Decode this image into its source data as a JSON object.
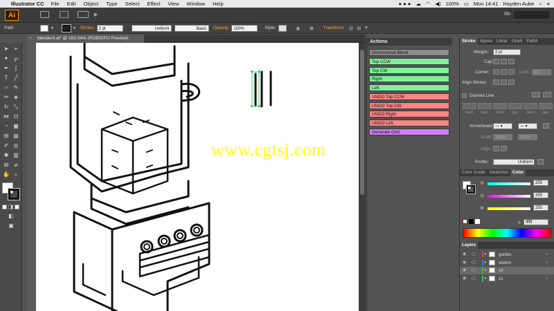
{
  "menubar": {
    "app_name": "Illustrator CC",
    "items": [
      "File",
      "Edit",
      "Object",
      "Type",
      "Select",
      "Effect",
      "View",
      "Window",
      "Help"
    ],
    "battery": "100%",
    "clock": "Mon 14:41",
    "user": "Hayden Aube"
  },
  "appbar": {
    "logo": "Ai",
    "workspace": "Illo"
  },
  "control_bar": {
    "selection_label": "Path",
    "stroke_label": "Stroke:",
    "stroke_value": "2 pt",
    "profile_label": "Uniform",
    "brush_label": "Basic",
    "opacity_label": "Opacity:",
    "opacity_value": "100%",
    "style_label": "Style:",
    "transform_label": "Transform"
  },
  "document": {
    "tab_title": "blender3.ai* @ 163.04% (RGB/GPU Preview)"
  },
  "watermark": "www.cgtsj.com",
  "actions_panel": {
    "title": "Actions",
    "set_name": "Dimensional Blend",
    "set_color": "#8e8e8e",
    "items": [
      {
        "label": "Top CCW",
        "color": "#7df29a"
      },
      {
        "label": "Top CW",
        "color": "#7df29a"
      },
      {
        "label": "Right",
        "color": "#7df29a"
      },
      {
        "label": "Left",
        "color": "#7df29a"
      },
      {
        "label": "UNDO Top CCW",
        "color": "#ff8585"
      },
      {
        "label": "UNDO Top CW",
        "color": "#ff8585"
      },
      {
        "label": "UNDO Right",
        "color": "#ff8585"
      },
      {
        "label": "UNDO Left",
        "color": "#ff8585"
      },
      {
        "label": "Generate Grid",
        "color": "#d27cf2"
      }
    ]
  },
  "stroke_panel": {
    "tabs": [
      "Stroke",
      "Appea",
      "Librar",
      "Gradi",
      "Pathfi"
    ],
    "weight_label": "Weight:",
    "weight_value": "2 pt",
    "cap_label": "Cap:",
    "corner_label": "Corner:",
    "limit_label": "Limit:",
    "limit_value": "10",
    "align_label": "Align Stroke:",
    "dashed_label": "Dashed Line",
    "dash_labels": [
      "dash",
      "gap",
      "dash",
      "gap",
      "dash",
      "gap"
    ],
    "arrowheads_label": "Arrowheads:",
    "scale_label": "Scale:",
    "scale_values": [
      "100%",
      "100%"
    ],
    "align_arrow_label": "Align:",
    "profile_label": "Profile:",
    "profile_value": "Uniform"
  },
  "color_panel": {
    "tabs": [
      "Color Guide",
      "Swatches",
      "Color"
    ],
    "channels": [
      {
        "name": "R",
        "value": "255"
      },
      {
        "name": "G",
        "value": "255"
      },
      {
        "name": "B",
        "value": "255"
      }
    ],
    "hex_value": "ffffff"
  },
  "layers_panel": {
    "title": "Layers",
    "layers": [
      {
        "name": "guides",
        "color": "#e04040"
      },
      {
        "name": "sketch",
        "color": "#3a7de0"
      },
      {
        "name": "v2",
        "color": "#40c040"
      },
      {
        "name": "v1",
        "color": "#40c040"
      }
    ]
  }
}
